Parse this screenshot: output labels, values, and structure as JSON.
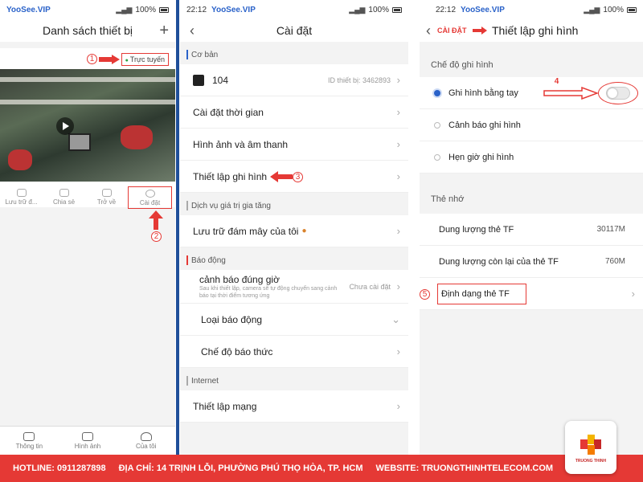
{
  "screen1": {
    "status": {
      "vip": "YooSee.VIP",
      "battery": "100%"
    },
    "title": "Danh sách thiết bị",
    "online": "Trực tuyến",
    "actions": [
      "Lưu trữ đ...",
      "Chia sẻ",
      "Trở về",
      "Cài đặt"
    ],
    "tabs": [
      "Thông tin",
      "Hình ảnh",
      "Của tôi"
    ],
    "step1": "1",
    "step2": "2"
  },
  "screen2": {
    "status": {
      "time": "22:12",
      "vip": "YooSee.VIP",
      "battery": "100%"
    },
    "title": "Cài đặt",
    "sec_basic": "Cơ bản",
    "device_name": "104",
    "device_id": "ID thiết bị: 3462893",
    "rows_basic": [
      "Cài đặt thời gian",
      "Hình ảnh và âm thanh",
      "Thiết lập ghi hình"
    ],
    "sec_value": "Dịch vụ giá trị gia tăng",
    "cloud": "Lưu trữ đám mây của tôi",
    "sec_alarm": "Báo động",
    "alarm_title": "cảnh báo đúng giờ",
    "alarm_sub": "Sau khi thiết lập, camera sẽ tự động chuyển sang cảnh báo tại thời điểm tương ứng",
    "alarm_status": "Chưa cài đặt",
    "alarm_type": "Loại báo động",
    "alarm_mode": "Chế độ báo thức",
    "sec_internet": "Internet",
    "network": "Thiết lập mạng",
    "step3": "3"
  },
  "screen3": {
    "status": {
      "time": "22:12",
      "vip": "YooSee.VIP",
      "battery": "100%"
    },
    "back_label": "CÀI ĐẶT",
    "title": "Thiết lập ghi hình",
    "sec_mode": "Chế độ ghi hình",
    "modes": [
      "Ghi hình bằng tay",
      "Cảnh báo ghi hình",
      "Hẹn giờ ghi hình"
    ],
    "sec_card": "Thẻ nhớ",
    "card_rows": [
      {
        "label": "Dung lượng thẻ TF",
        "value": "30117M"
      },
      {
        "label": "Dung lượng còn lại của thẻ TF",
        "value": "760M"
      }
    ],
    "format": "Định dạng thẻ TF",
    "step4": "4",
    "step5": "5"
  },
  "footer": {
    "hotline": "HOTLINE: 0911287898",
    "address": "ĐỊA CHỈ: 14 TRỊNH LỖI, PHƯỜNG PHÚ THỌ HÒA, TP. HCM",
    "website": "WEBSITE: TRUONGTHINHTELECOM.COM",
    "logo_text": "TRUONG THINH"
  },
  "colors": {
    "accent": "#2a62c9",
    "red": "#e53935",
    "separator": "#1f4f9a"
  }
}
